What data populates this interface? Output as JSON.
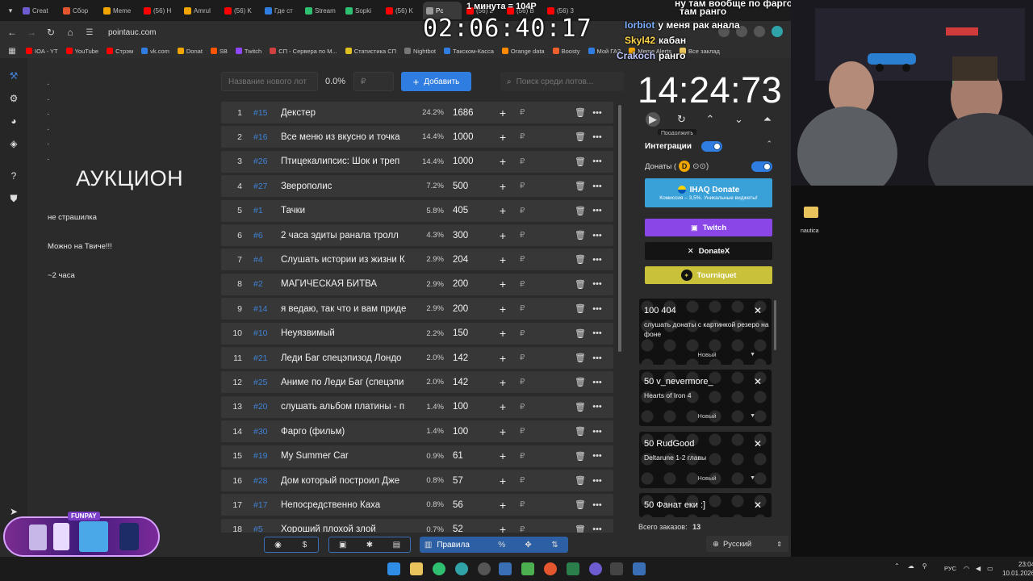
{
  "browser": {
    "tabs": [
      {
        "label": "Creat",
        "color": "#6d5bd0"
      },
      {
        "label": "Сбор",
        "color": "#e4572e"
      },
      {
        "label": "Meme",
        "color": "#f0a500"
      },
      {
        "label": "(56) H",
        "color": "#ff0000"
      },
      {
        "label": "Amrul",
        "color": "#f0a500"
      },
      {
        "label": "(56) K",
        "color": "#ff0000"
      },
      {
        "label": "Где ст",
        "color": "#2f7de0"
      },
      {
        "label": "Stream",
        "color": "#2fbf71"
      },
      {
        "label": "Sopki",
        "color": "#2fbf71"
      },
      {
        "label": "(56) K",
        "color": "#ff0000"
      },
      {
        "label": "Pc",
        "color": "#999999"
      },
      {
        "label": "(56) 2",
        "color": "#ff0000"
      },
      {
        "label": "(56) В",
        "color": "#ff0000"
      },
      {
        "label": "(56) 3",
        "color": "#ff0000"
      }
    ],
    "url": "pointauc.com",
    "bookmarks": [
      {
        "label": "IOA - YT",
        "color": "#ff0000"
      },
      {
        "label": "YouTube",
        "color": "#ff0000"
      },
      {
        "label": "Стрэм",
        "color": "#ff0000"
      },
      {
        "label": "vk.com",
        "color": "#2f7de0"
      },
      {
        "label": "Donat",
        "color": "#f0a500"
      },
      {
        "label": "SB",
        "color": "#ff5500"
      },
      {
        "label": "Twitch",
        "color": "#9146ff"
      },
      {
        "label": "СП - Сервера по M...",
        "color": "#d04040"
      },
      {
        "label": "Статистика СП",
        "color": "#e0c020"
      },
      {
        "label": "Nightbot",
        "color": "#777777"
      },
      {
        "label": "Такском-Касса",
        "color": "#2f7de0"
      },
      {
        "label": "Orange data",
        "color": "#ff8a00"
      },
      {
        "label": "Boosty",
        "color": "#f15f2c"
      },
      {
        "label": "Мой ГАЗ",
        "color": "#2f7de0"
      },
      {
        "label": "Meme Alerts",
        "color": "#f0a500"
      },
      {
        "label": "Все заклад",
        "color": "#e9c35b"
      }
    ]
  },
  "overlay": {
    "subtitle": "1 минута = 104Р",
    "timer": "02:06:40:17",
    "chat": [
      {
        "nick": "Iorbiot",
        "text": "у меня рак анала",
        "color": "#7fb0ff"
      },
      {
        "nick": "Skyl42",
        "text": "кабан",
        "color": "#ffd54a"
      },
      {
        "nick": "Crakoch",
        "text": "ранго",
        "color": "#bfc8ff"
      },
      {
        "nick": "",
        "text": "ну там вообще по фарго,",
        "color": "#ffffff"
      },
      {
        "nick": "",
        "text": "там ранго",
        "color": "#ffffff"
      }
    ]
  },
  "left": {
    "title": "АУКЦИОН",
    "notes": [
      "не страшилка",
      "Можно на  Твиче!!!",
      "~2 часа"
    ]
  },
  "controls": {
    "lot_placeholder": "Название нового лот",
    "percent": "0.0%",
    "price_placeholder": "₽",
    "add_label": "Добавить",
    "search_placeholder": "Поиск среди лотов..."
  },
  "lots": [
    {
      "n": "1",
      "id": "#15",
      "name": "Декстер",
      "pct": "24.2%",
      "amount": "1686"
    },
    {
      "n": "2",
      "id": "#16",
      "name": "Все меню из вкусно и точка",
      "pct": "14.4%",
      "amount": "1000"
    },
    {
      "n": "3",
      "id": "#26",
      "name": "Птицекалипсис: Шок и треп",
      "pct": "14.4%",
      "amount": "1000"
    },
    {
      "n": "4",
      "id": "#27",
      "name": "Зверополис",
      "pct": "7.2%",
      "amount": "500"
    },
    {
      "n": "5",
      "id": "#1",
      "name": "Тачки",
      "pct": "5.8%",
      "amount": "405"
    },
    {
      "n": "6",
      "id": "#6",
      "name": "2 часа эдиты ранала тролл",
      "pct": "4.3%",
      "amount": "300"
    },
    {
      "n": "7",
      "id": "#4",
      "name": "Слушать истории из жизни К",
      "pct": "2.9%",
      "amount": "204"
    },
    {
      "n": "8",
      "id": "#2",
      "name": "МАГИЧЕСКАЯ БИТВА",
      "pct": "2.9%",
      "amount": "200"
    },
    {
      "n": "9",
      "id": "#14",
      "name": "я ведаю, так что и вам приде",
      "pct": "2.9%",
      "amount": "200"
    },
    {
      "n": "10",
      "id": "#10",
      "name": "Неуязвимый",
      "pct": "2.2%",
      "amount": "150"
    },
    {
      "n": "11",
      "id": "#21",
      "name": "Леди Баг спецэпизод Лондо",
      "pct": "2.0%",
      "amount": "142"
    },
    {
      "n": "12",
      "id": "#25",
      "name": "Аниме по Леди Баг (спецэпи",
      "pct": "2.0%",
      "amount": "142"
    },
    {
      "n": "13",
      "id": "#20",
      "name": "слушать альбом платины - п",
      "pct": "1.4%",
      "amount": "100"
    },
    {
      "n": "14",
      "id": "#30",
      "name": "Фарго (фильм)",
      "pct": "1.4%",
      "amount": "100"
    },
    {
      "n": "15",
      "id": "#19",
      "name": "My Summer Car",
      "pct": "0.9%",
      "amount": "61"
    },
    {
      "n": "16",
      "id": "#28",
      "name": "Дом который построил Дже",
      "pct": "0.8%",
      "amount": "57"
    },
    {
      "n": "17",
      "id": "#17",
      "name": "Непосредственно Каха",
      "pct": "0.8%",
      "amount": "56"
    },
    {
      "n": "18",
      "id": "#5",
      "name": "Хороший плохой злой",
      "pct": "0.7%",
      "amount": "52"
    }
  ],
  "currency": "₽",
  "toolbar": {
    "rules_label": "Правила",
    "percent_label": "%"
  },
  "right": {
    "timer": "14:24:73",
    "tooltip": "Продолжить",
    "integrations_label": "Интеграции",
    "donations_label": "Донаты (",
    "services": [
      {
        "label": "IHAQ Donate",
        "sub": "Комиссия – 3,5%. Уникальные виджеты!",
        "bg": "#3aa0d8"
      },
      {
        "label": "Twitch",
        "bg": "#8a46e6"
      },
      {
        "label": "DonateX",
        "bg": "#141414"
      },
      {
        "label": "Tourniquet",
        "bg": "#c9c13a"
      }
    ],
    "donations": [
      {
        "title": "100 404",
        "msg": "слушать донаты с картинкой резеро на фоне",
        "status": "Новый"
      },
      {
        "title": "50 v_nevermore_",
        "msg": "Hearts of Iron 4",
        "status": "Новый"
      },
      {
        "title": "50 RudGood",
        "msg": "Deltarune 1-2 главы",
        "status": "Новый"
      },
      {
        "title": "50 Фанат еки :]",
        "msg": "",
        "status": ""
      }
    ],
    "orders_label": "Всего заказов:",
    "orders_count": "13",
    "language": "Русский"
  },
  "desktop": {
    "folder_label": "nautica",
    "promo_label": "FUNPAY"
  },
  "taskbar": {
    "lang": "РУС",
    "time": "23:04",
    "date": "10.01.2026"
  }
}
